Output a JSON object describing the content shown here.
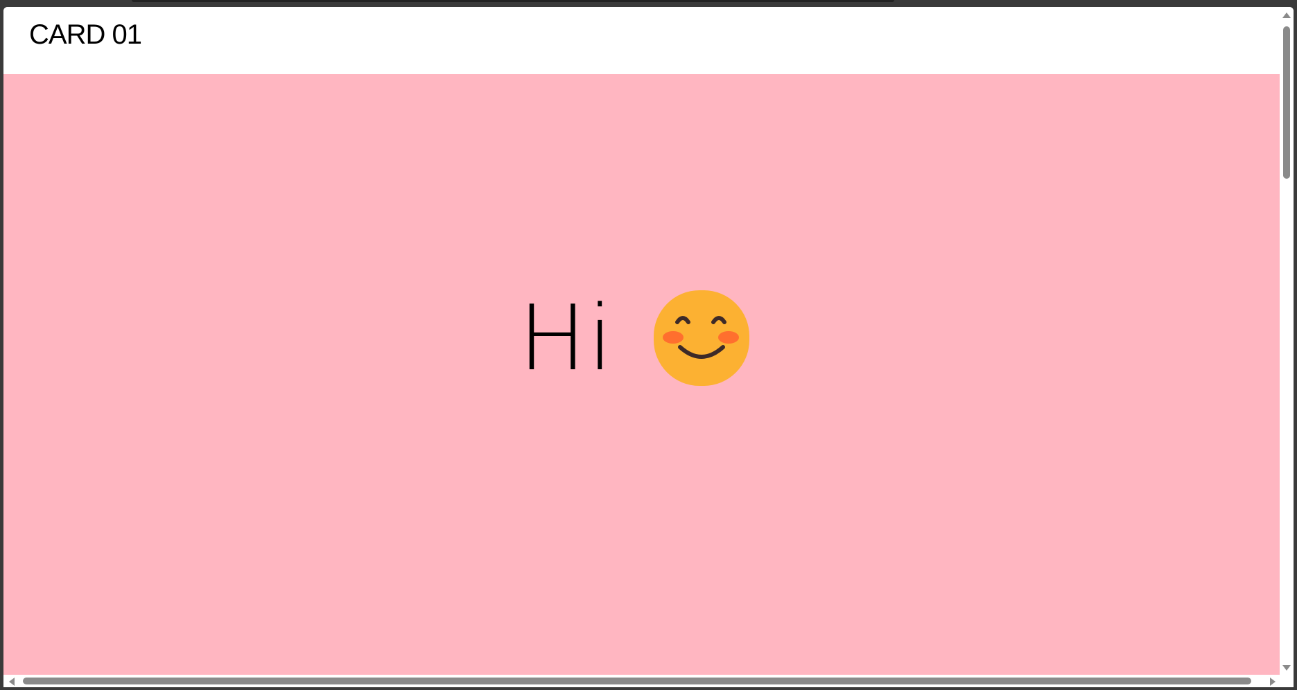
{
  "card": {
    "title": "CARD 01"
  },
  "main": {
    "greeting": "Hi",
    "emoji_icon": "smiling-face-with-smiling-eyes-icon",
    "background_color": "#ffb6c1"
  },
  "colors": {
    "emoji_face": "#fcb132",
    "emoji_features": "#3d2a28",
    "emoji_cheeks": "#ff6f2e"
  }
}
